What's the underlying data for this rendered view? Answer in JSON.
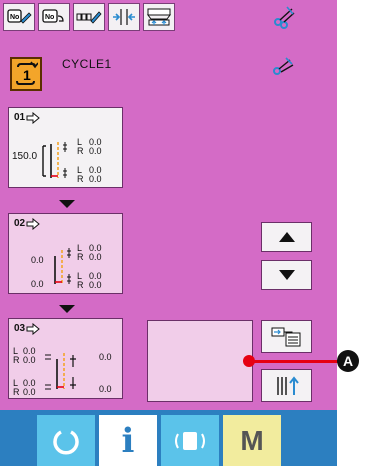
{
  "toolbar": {
    "buttons": [
      {
        "name": "pattern-number-edit-icon"
      },
      {
        "name": "pattern-number-link-icon"
      },
      {
        "name": "cycle-edit-icon"
      },
      {
        "name": "feed-adjust-icon"
      },
      {
        "name": "stacker-icon"
      }
    ],
    "tools_icon": "scissors-icon"
  },
  "cycle": {
    "label": "CYCLE1",
    "icon_text": "1"
  },
  "steps": [
    {
      "number": "01",
      "left_value": "150.0",
      "top_values": [
        "0.0",
        "0.0"
      ],
      "bottom_values": [
        "0.0",
        "0.0"
      ],
      "letters": [
        "L",
        "R"
      ]
    },
    {
      "number": "02",
      "left_top": "0.0",
      "left_bottom": "0.0",
      "top_values": [
        "0.0",
        "0.0"
      ],
      "bottom_values": [
        "0.0",
        "0.0"
      ],
      "letters": [
        "L",
        "R"
      ]
    },
    {
      "number": "03",
      "left_top": [
        "0.0",
        "0.0"
      ],
      "left_bottom": [
        "0.0",
        "0.0"
      ],
      "right_top": "0.0",
      "right_bottom": "0.0",
      "letters": [
        "L",
        "R"
      ]
    }
  ],
  "bottombar": {
    "buttons": [
      "ready-icon",
      "information-icon",
      "communication-icon",
      "mode-icon"
    ],
    "mode_label": "M",
    "info_label": "i"
  },
  "annotation": {
    "label": "A",
    "color": "#e60012"
  },
  "colors": {
    "background": "#d46bc6",
    "card_light": "#f4f2f4",
    "card_pink": "#f1cde9",
    "bottom_bar": "#2c7fc0",
    "cycle_orange": "#f3a52a"
  }
}
